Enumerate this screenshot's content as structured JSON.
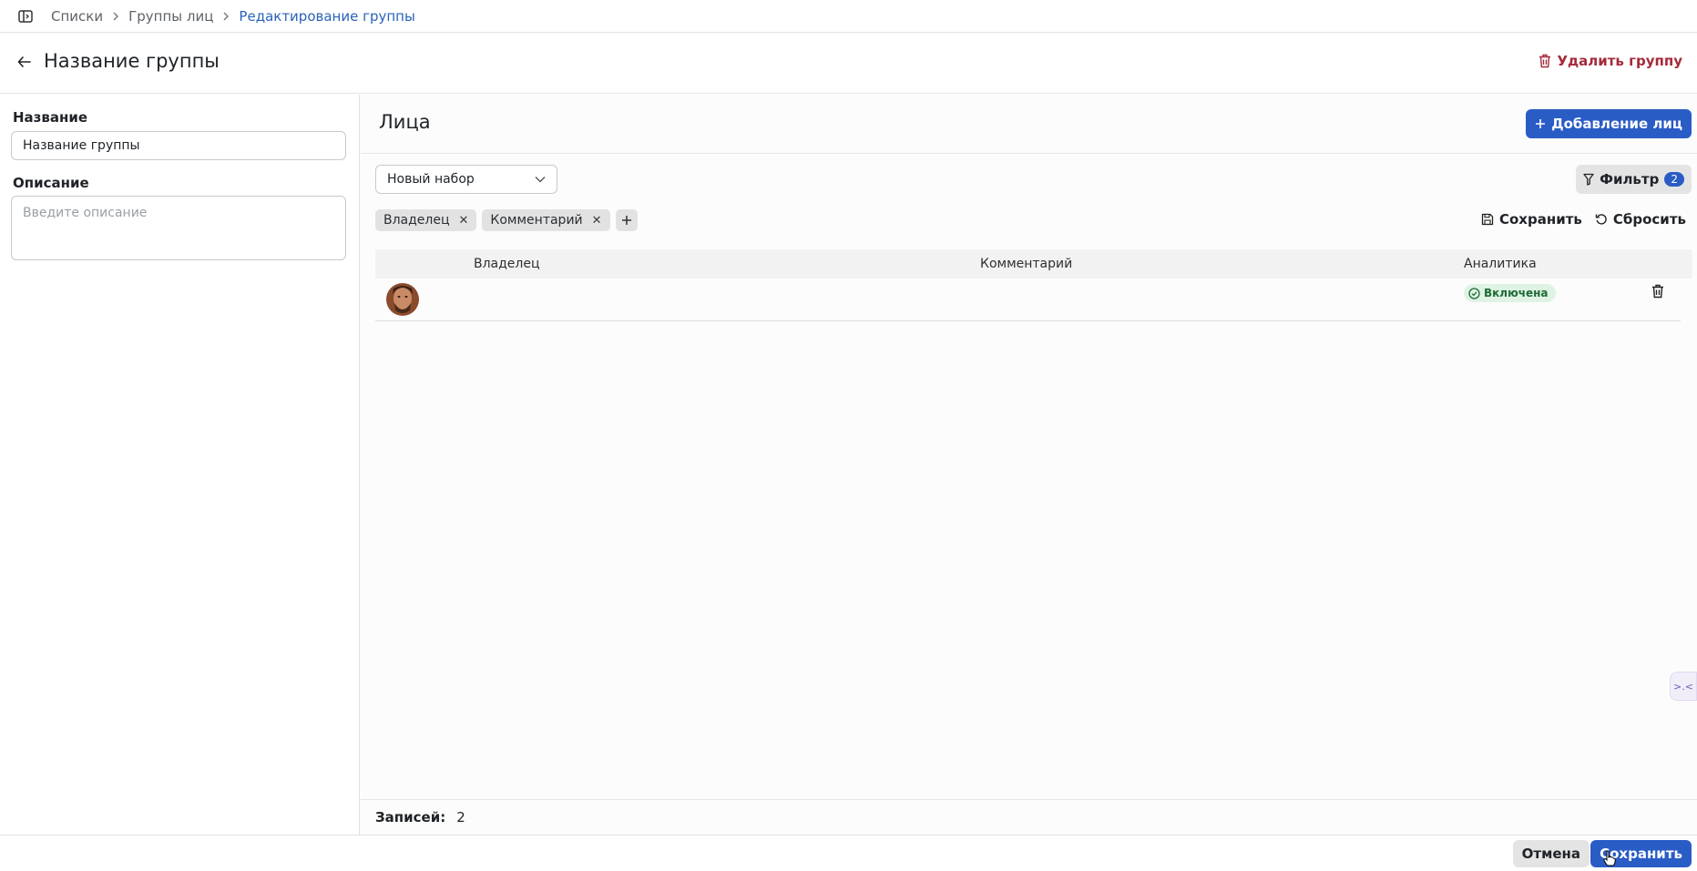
{
  "breadcrumb": {
    "items": [
      "Списки",
      "Группы лиц"
    ],
    "current": "Редактирование группы"
  },
  "header": {
    "title": "Название группы",
    "delete_label": "Удалить группу"
  },
  "form": {
    "name_label": "Название",
    "name_value": "Название группы",
    "description_label": "Описание",
    "description_placeholder": "Введите описание"
  },
  "faces": {
    "title": "Лица",
    "add_label": "Добавление лиц",
    "preset_value": "Новый набор",
    "filter_label": "Фильтр",
    "filter_count": "2",
    "chips": [
      "Владелец",
      "Комментарий"
    ],
    "save_label": "Сохранить",
    "reset_label": "Сбросить",
    "columns": [
      "Владелец",
      "Комментарий",
      "Аналитика"
    ],
    "rows": [
      {
        "owner": "",
        "comment": "",
        "analytics": "Включена"
      }
    ],
    "records_label": "Записей:",
    "records_count": "2"
  },
  "footer": {
    "cancel_label": "Отмена",
    "save_label": "Сохранить"
  },
  "colors": {
    "primary": "#2a5cc6",
    "danger": "#a52a3a",
    "link": "#2a62b8",
    "status_bg": "#dff3e4",
    "status_fg": "#1e6b35"
  }
}
